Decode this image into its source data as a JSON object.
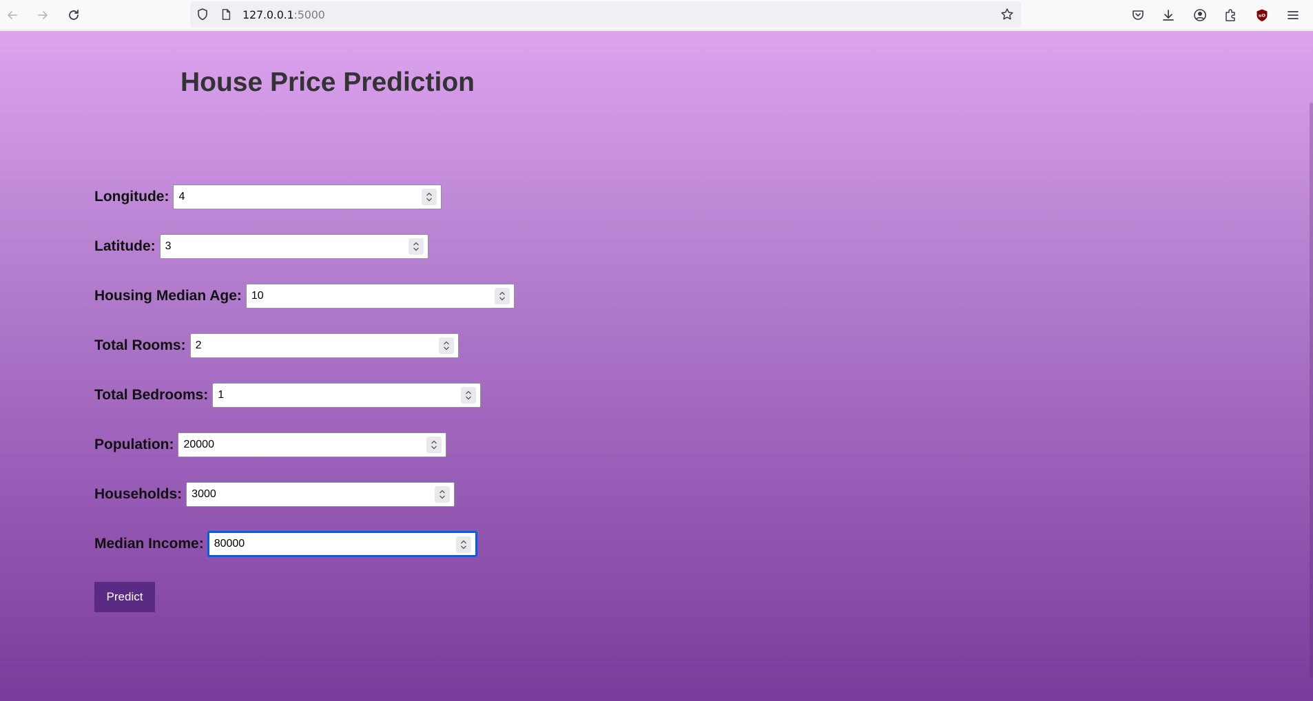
{
  "browser": {
    "url_host": "127.0.0.1",
    "url_port": ":5000",
    "icons": [
      "back-arrow-icon",
      "forward-arrow-icon",
      "reload-icon",
      "shield-icon",
      "page-icon",
      "bookmark-star-icon",
      "pocket-icon",
      "download-icon",
      "account-icon",
      "extensions-icon",
      "ublock-icon",
      "menu-icon"
    ]
  },
  "page": {
    "title": "House Price Prediction",
    "fields": [
      {
        "label": "Longitude:",
        "value": "4"
      },
      {
        "label": "Latitude:",
        "value": "3"
      },
      {
        "label": "Housing Median Age:",
        "value": "10"
      },
      {
        "label": "Total Rooms:",
        "value": "2"
      },
      {
        "label": "Total Bedrooms:",
        "value": "1"
      },
      {
        "label": "Population:",
        "value": "20000"
      },
      {
        "label": "Households:",
        "value": "3000"
      },
      {
        "label": "Median Income:",
        "value": "80000"
      }
    ],
    "predict_label": "Predict"
  },
  "colors": {
    "button": "#5a2b84",
    "gradient_top": "#dda3ef",
    "gradient_bottom": "#7a3c9c",
    "focus": "#0060df"
  }
}
